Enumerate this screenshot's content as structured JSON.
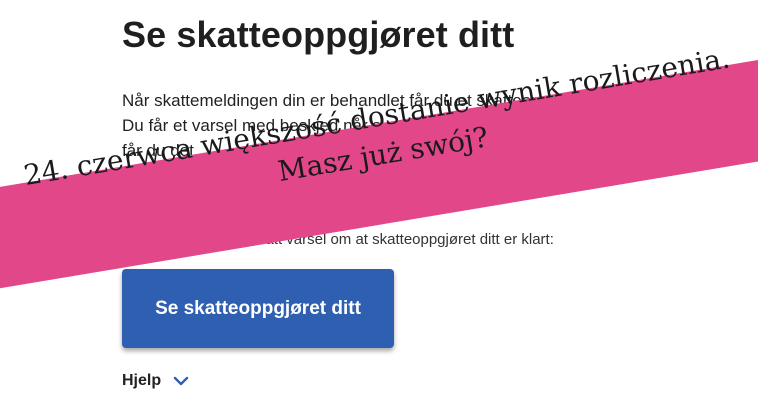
{
  "page": {
    "title": "Se skatteoppgjøret ditt",
    "paragraph_lines": [
      "Når skattemeldingen din er behandlet får du et skatteoppgjør.",
      "Du får et varsel med beskjed når skatteoppgjøret er klart.",
      "får du det"
    ],
    "login_hint": "Logg inn hvis du har fått varsel om at skatteoppgjøret ditt er klart:",
    "primary_button": "Se skatteoppgjøret ditt",
    "help_label": "Hjelp",
    "help_icon": "chevron-down-icon"
  },
  "overlay": {
    "line1": "24. czerwca większość dostanie wynik rozliczenia.",
    "line2": "Masz już swój?",
    "background_color": "#e2478a"
  },
  "colors": {
    "button_bg": "#2f5fb0",
    "chevron": "#2f5fb0"
  }
}
